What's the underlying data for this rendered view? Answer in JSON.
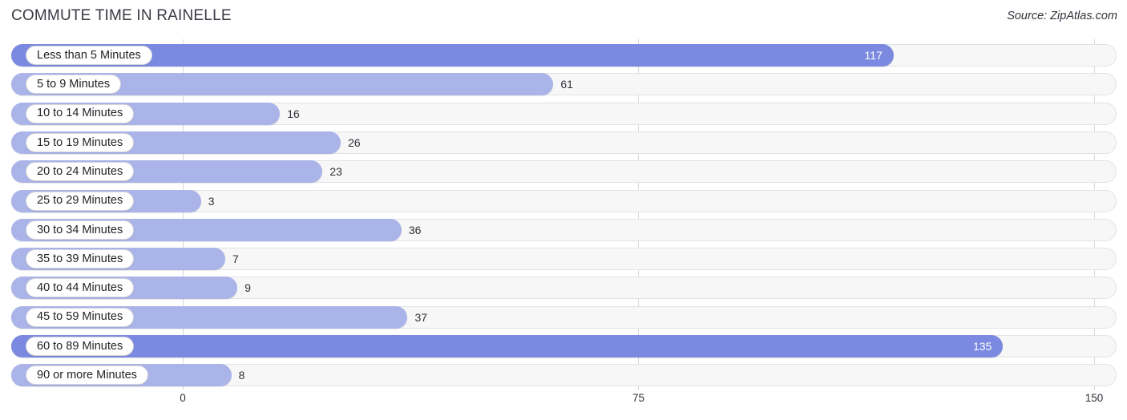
{
  "header": {
    "title": "COMMUTE TIME IN RAINELLE",
    "source": "Source: ZipAtlas.com"
  },
  "colors": {
    "bar_light": "#aab4e8",
    "bar_dark": "#7b8ae0",
    "track": "#f7f7f7",
    "track_border": "#e3e3e6",
    "gridline": "#d8d8dc",
    "text": "#303038",
    "value_inside": "#ffffff"
  },
  "chart_data": {
    "type": "bar",
    "orientation": "horizontal",
    "title": "COMMUTE TIME IN RAINELLE",
    "subtitle": "",
    "xlabel": "",
    "ylabel": "",
    "xlim": [
      0,
      150
    ],
    "xticks": [
      0,
      75,
      150
    ],
    "xtick_labels": [
      "0",
      "75",
      "150"
    ],
    "grid": true,
    "legend": false,
    "categories": [
      "Less than 5 Minutes",
      "5 to 9 Minutes",
      "10 to 14 Minutes",
      "15 to 19 Minutes",
      "20 to 24 Minutes",
      "25 to 29 Minutes",
      "30 to 34 Minutes",
      "35 to 39 Minutes",
      "40 to 44 Minutes",
      "45 to 59 Minutes",
      "60 to 89 Minutes",
      "90 or more Minutes"
    ],
    "values": [
      117,
      61,
      16,
      26,
      23,
      3,
      36,
      7,
      9,
      37,
      135,
      8
    ],
    "value_labels": [
      "117",
      "61",
      "16",
      "26",
      "23",
      "3",
      "36",
      "7",
      "9",
      "37",
      "135",
      "8"
    ]
  },
  "rows": [
    {
      "label": "Less than 5 Minutes",
      "value": 117,
      "value_label": "117",
      "inside": true,
      "dark": true
    },
    {
      "label": "5 to 9 Minutes",
      "value": 61,
      "value_label": "61",
      "inside": false,
      "dark": false
    },
    {
      "label": "10 to 14 Minutes",
      "value": 16,
      "value_label": "16",
      "inside": false,
      "dark": false
    },
    {
      "label": "15 to 19 Minutes",
      "value": 26,
      "value_label": "26",
      "inside": false,
      "dark": false
    },
    {
      "label": "20 to 24 Minutes",
      "value": 23,
      "value_label": "23",
      "inside": false,
      "dark": false
    },
    {
      "label": "25 to 29 Minutes",
      "value": 3,
      "value_label": "3",
      "inside": false,
      "dark": false
    },
    {
      "label": "30 to 34 Minutes",
      "value": 36,
      "value_label": "36",
      "inside": false,
      "dark": false
    },
    {
      "label": "35 to 39 Minutes",
      "value": 7,
      "value_label": "7",
      "inside": false,
      "dark": false
    },
    {
      "label": "40 to 44 Minutes",
      "value": 9,
      "value_label": "9",
      "inside": false,
      "dark": false
    },
    {
      "label": "45 to 59 Minutes",
      "value": 37,
      "value_label": "37",
      "inside": false,
      "dark": false
    },
    {
      "label": "60 to 89 Minutes",
      "value": 135,
      "value_label": "135",
      "inside": true,
      "dark": true
    },
    {
      "label": "90 or more Minutes",
      "value": 8,
      "value_label": "8",
      "inside": false,
      "dark": false
    }
  ],
  "axis": {
    "ticks": [
      {
        "label": "0",
        "value": 0
      },
      {
        "label": "75",
        "value": 75
      },
      {
        "label": "150",
        "value": 150
      }
    ]
  }
}
